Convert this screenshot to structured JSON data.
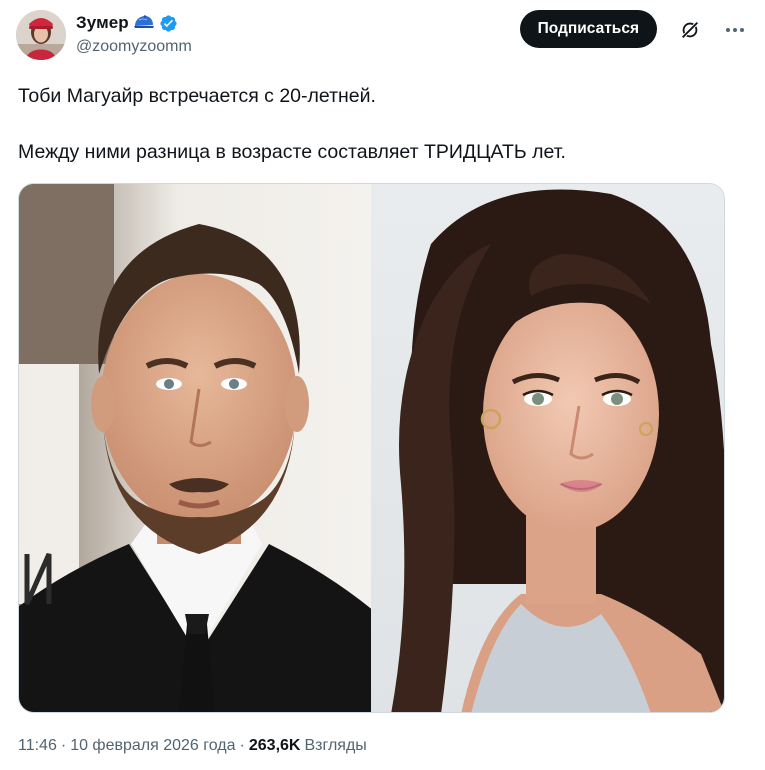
{
  "author": {
    "display_name": "Зумер",
    "handle": "@zoomyzoomm",
    "badge_icon": "cap-emoji-icon",
    "verified_icon": "verified-badge-icon",
    "verified_color": "#1d9bf0"
  },
  "actions": {
    "follow_label": "Подписаться",
    "grok_icon": "grok-icon",
    "more_icon": "more-options-icon"
  },
  "tweet": {
    "line1": "Тоби Магуайр встречается с 20-летней.",
    "line2": "Между ними разница в возрасте составляет ТРИДЦАТЬ лет."
  },
  "media": {
    "left_photo": "man-portrait-photo",
    "right_photo": "woman-portrait-photo"
  },
  "meta": {
    "time": "11:46",
    "sep1": "·",
    "date": "10 февраля 2026 года",
    "sep2": "·",
    "views_count": "263,6K",
    "views_label": "Взгляды"
  },
  "colors": {
    "text": "#0f1419",
    "secondary": "#536471",
    "button_bg": "#0f1419"
  }
}
